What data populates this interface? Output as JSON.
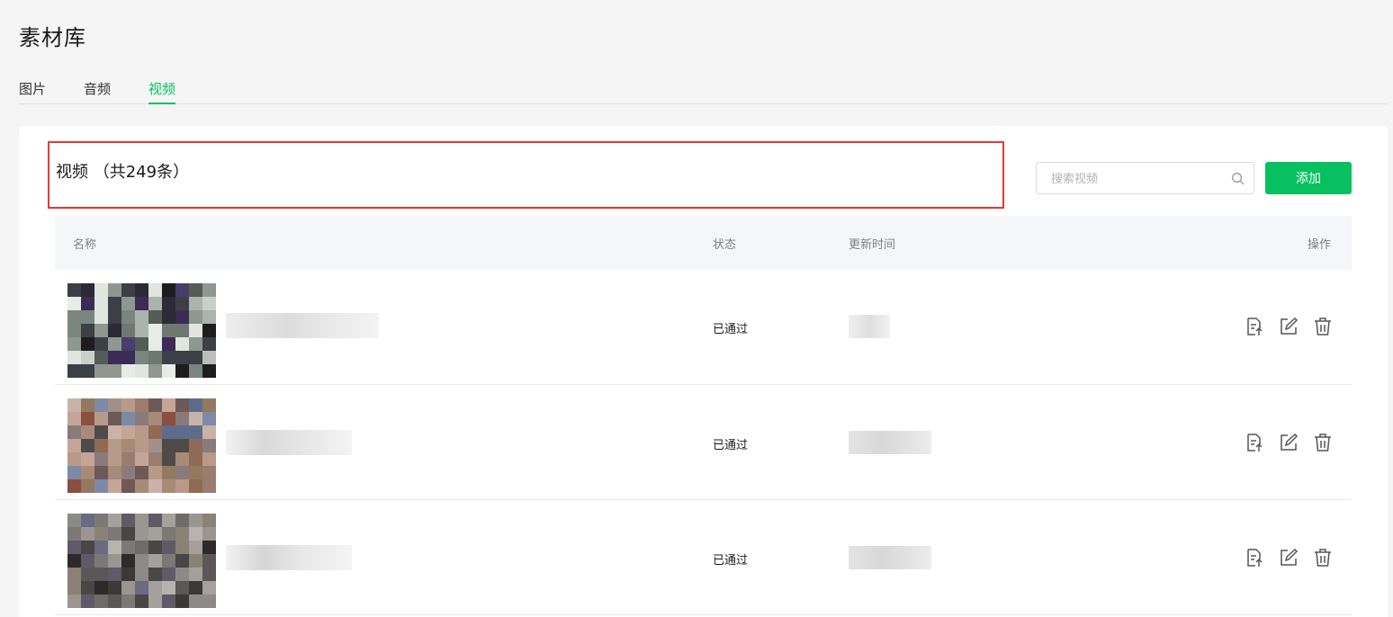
{
  "page": {
    "title": "素材库"
  },
  "tabs": [
    {
      "label": "图片",
      "active": false
    },
    {
      "label": "音频",
      "active": false
    },
    {
      "label": "视频",
      "active": true
    }
  ],
  "section": {
    "title": "视频 （共249条）"
  },
  "search": {
    "placeholder": "搜索视频",
    "value": ""
  },
  "add_button": {
    "label": "添加"
  },
  "table": {
    "headers": {
      "name": "名称",
      "status": "状态",
      "updated": "更新时间",
      "actions": "操作"
    },
    "rows": [
      {
        "status": "已通过"
      },
      {
        "status": "已通过"
      },
      {
        "status": "已通过"
      }
    ]
  },
  "icons": {
    "search": "search-icon",
    "publish": "document-upload-icon",
    "edit": "edit-icon",
    "delete": "trash-icon"
  },
  "colors": {
    "accent": "#07c160",
    "highlight": "#e53935",
    "background": "#f5f5f6"
  }
}
